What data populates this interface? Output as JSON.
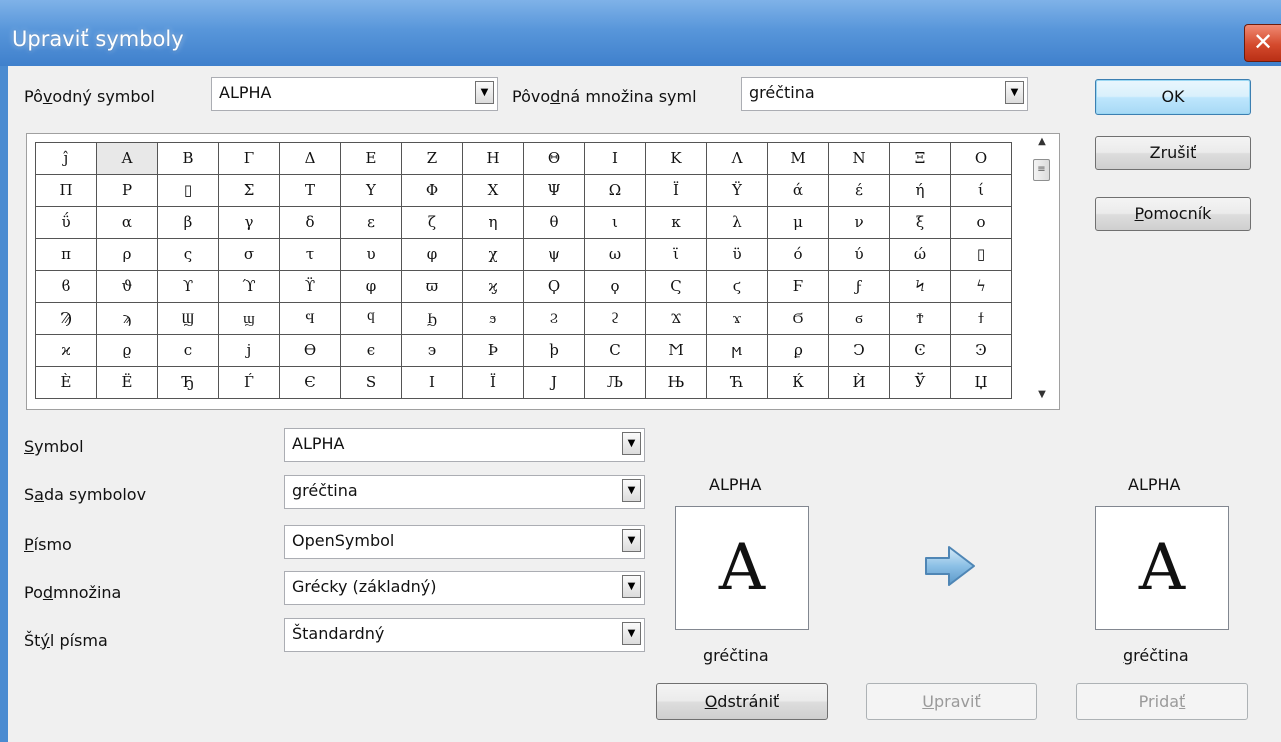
{
  "window": {
    "title": "Upraviť symboly",
    "close_glyph": "✕"
  },
  "top": {
    "original_symbol_label_pre": "Pô",
    "original_symbol_label_ul": "v",
    "original_symbol_label_post": "odný symbol",
    "original_symbol_value": "ALPHA",
    "original_set_label_pre": "Pôvo",
    "original_set_label_ul": "d",
    "original_set_label_post": "ná množina syml",
    "original_set_value": "gréčtina"
  },
  "buttons": {
    "ok": "OK",
    "cancel": "Zrušiť",
    "help_ul": "P",
    "help_rest": "omocník",
    "delete_ul": "O",
    "delete_rest": "dstrániť",
    "modify_ul": "U",
    "modify_rest": "praviť",
    "add_pre": "Prida",
    "add_ul": "ť"
  },
  "glyph_grid": {
    "rows": [
      [
        "ĵ",
        "Α",
        "Β",
        "Γ",
        "Δ",
        "Ε",
        "Ζ",
        "Η",
        "Θ",
        "Ι",
        "Κ",
        "Λ",
        "Μ",
        "Ν",
        "Ξ",
        "Ο"
      ],
      [
        "Π",
        "Ρ",
        "▯",
        "Σ",
        "Τ",
        "Υ",
        "Φ",
        "Χ",
        "Ψ",
        "Ω",
        "Ϊ",
        "Ϋ",
        "ά",
        "έ",
        "ή",
        "ί"
      ],
      [
        "ΰ",
        "α",
        "β",
        "γ",
        "δ",
        "ε",
        "ζ",
        "η",
        "θ",
        "ι",
        "κ",
        "λ",
        "μ",
        "ν",
        "ξ",
        "ο"
      ],
      [
        "π",
        "ρ",
        "ς",
        "σ",
        "τ",
        "υ",
        "φ",
        "χ",
        "ψ",
        "ω",
        "ϊ",
        "ϋ",
        "ό",
        "ύ",
        "ώ",
        "▯"
      ],
      [
        "ϐ",
        "ϑ",
        "ϒ",
        "ϓ",
        "ϔ",
        "φ",
        "ϖ",
        "ϗ",
        "Ϙ",
        "ϙ",
        "Ϛ",
        "ϛ",
        "Ϝ",
        "ϝ",
        "Ϟ",
        "ϟ"
      ],
      [
        "Ϡ",
        "ϡ",
        "Ϣ",
        "ϣ",
        "Ϥ",
        "ϥ",
        "Ϧ",
        "ϧ",
        "Ϩ",
        "ϩ",
        "Ϫ",
        "ϫ",
        "Ϭ",
        "ϭ",
        "Ϯ",
        "ϯ"
      ],
      [
        "ϰ",
        "ϱ",
        "ϲ",
        "ϳ",
        "ϴ",
        "ϵ",
        "϶",
        "Ϸ",
        "ϸ",
        "Ϲ",
        "Ϻ",
        "ϻ",
        "ϼ",
        "Ͻ",
        "Ͼ",
        "Ͽ"
      ],
      [
        "Ѐ",
        "Ё",
        "Ђ",
        "Ѓ",
        "Є",
        "Ѕ",
        "І",
        "Ї",
        "Ј",
        "Љ",
        "Њ",
        "Ћ",
        "Ќ",
        "Ѝ",
        "Ў",
        "Џ"
      ]
    ],
    "selected": "Α",
    "scroll_up": "▲",
    "scroll_down": "▼",
    "thumb_glyph": "≡"
  },
  "form": {
    "symbol_label_ul": "S",
    "symbol_label_rest": "ymbol",
    "symbol_value": "ALPHA",
    "set_label_pre": "S",
    "set_label_ul": "a",
    "set_label_post": "da symbolov",
    "set_value": "gréčtina",
    "font_label_ul": "P",
    "font_label_rest": "ísmo",
    "font_value": "OpenSymbol",
    "subset_label_pre": "Po",
    "subset_label_ul": "d",
    "subset_label_post": "množina",
    "subset_value": "Grécky (základný)",
    "style_label_pre": "Št",
    "style_label_ul": "ý",
    "style_label_post": "l písma",
    "style_value": "Štandardný"
  },
  "preview": {
    "old_name": "ALPHA",
    "old_glyph": "A",
    "old_set": "gréčtina",
    "new_name": "ALPHA",
    "new_glyph": "A",
    "new_set_ul": "g",
    "new_set_rest": "réčtina",
    "arrow_icon": "arrow-right"
  },
  "combo_arrow": "▼",
  "colors": {
    "titlebar": "#4a8bd1",
    "close": "#c7432a",
    "arrow": "#7fb6e0"
  }
}
